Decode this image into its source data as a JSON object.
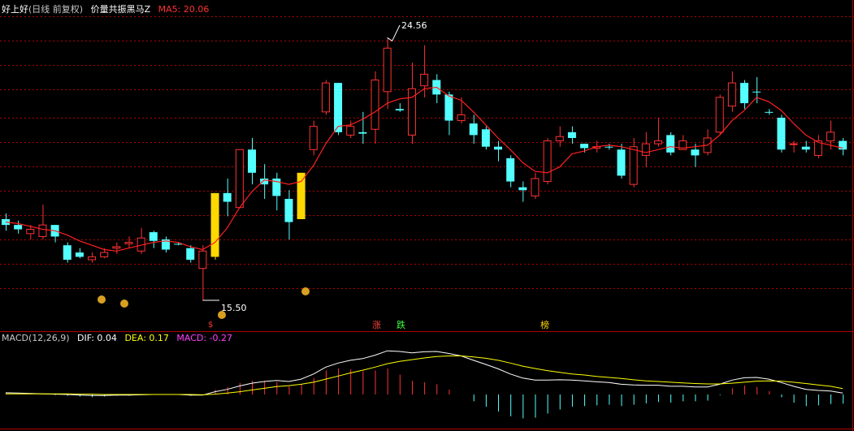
{
  "header": {
    "stock": "好上好",
    "period": "(日线 前复权)",
    "indicator_name": "价量共振黑马Z",
    "ma_label": "MA5: 20.06"
  },
  "macd_header": {
    "name": "MACD(12,26,9)",
    "dif": "DIF: 0.04",
    "dea": "DEA: 0.17",
    "macd": "MACD: -0.27"
  },
  "annotations": {
    "high_label": "24.56",
    "low_label": "15.50",
    "marker_zhang": "涨",
    "marker_die": "跌",
    "marker_bang": "榜"
  },
  "colors": {
    "up": "#ff3232",
    "down": "#54ffff",
    "signal": "#ffd800",
    "ma5": "#ff2020",
    "dif": "#ffffff",
    "dea": "#ffff00",
    "macd_text": "#ff40ff",
    "grid": "#b00000"
  },
  "chart_data": [
    {
      "type": "candlestick",
      "title": "价量共振黑马Z",
      "ylim": [
        14.8,
        25.3
      ],
      "high_marker": 24.56,
      "low_marker": 15.5,
      "series": [
        {
          "name": "K",
          "candles": [
            {
              "o": 18.3,
              "c": 18.1,
              "h": 18.5,
              "l": 17.9,
              "k": "d"
            },
            {
              "o": 18.1,
              "c": 17.95,
              "h": 18.25,
              "l": 17.8,
              "k": "d"
            },
            {
              "o": 17.8,
              "c": 17.95,
              "h": 18.1,
              "l": 17.6,
              "k": "u"
            },
            {
              "o": 17.7,
              "c": 18.1,
              "h": 18.8,
              "l": 17.6,
              "k": "u"
            },
            {
              "o": 18.1,
              "c": 17.7,
              "h": 18.1,
              "l": 17.5,
              "k": "d"
            },
            {
              "o": 17.4,
              "c": 16.9,
              "h": 17.5,
              "l": 16.8,
              "k": "d"
            },
            {
              "o": 17.15,
              "c": 17.0,
              "h": 17.3,
              "l": 16.95,
              "k": "d"
            },
            {
              "o": 16.9,
              "c": 17.0,
              "h": 17.15,
              "l": 16.8,
              "k": "u"
            },
            {
              "o": 17.0,
              "c": 17.15,
              "h": 17.3,
              "l": 16.95,
              "k": "u"
            },
            {
              "o": 17.3,
              "c": 17.35,
              "h": 17.5,
              "l": 17.1,
              "k": "u"
            },
            {
              "o": 17.45,
              "c": 17.5,
              "h": 17.7,
              "l": 17.3,
              "k": "u"
            },
            {
              "o": 17.2,
              "c": 17.65,
              "h": 18.0,
              "l": 17.1,
              "k": "u"
            },
            {
              "o": 17.85,
              "c": 17.55,
              "h": 17.9,
              "l": 17.3,
              "k": "d"
            },
            {
              "o": 17.6,
              "c": 17.25,
              "h": 17.7,
              "l": 17.15,
              "k": "d"
            },
            {
              "o": 17.45,
              "c": 17.45,
              "h": 17.5,
              "l": 17.4,
              "k": "d"
            },
            {
              "o": 17.3,
              "c": 16.9,
              "h": 17.4,
              "l": 16.8,
              "k": "d"
            },
            {
              "o": 16.6,
              "c": 17.2,
              "h": 17.4,
              "l": 15.5,
              "k": "u"
            },
            {
              "o": 17.0,
              "c": 19.2,
              "h": 19.2,
              "l": 16.9,
              "k": "s"
            },
            {
              "o": 19.2,
              "c": 18.9,
              "h": 19.7,
              "l": 18.4,
              "k": "d"
            },
            {
              "o": 18.7,
              "c": 20.7,
              "h": 20.7,
              "l": 18.7,
              "k": "u"
            },
            {
              "o": 20.7,
              "c": 19.9,
              "h": 21.1,
              "l": 19.5,
              "k": "d"
            },
            {
              "o": 19.7,
              "c": 19.5,
              "h": 20.2,
              "l": 19.0,
              "k": "d"
            },
            {
              "o": 19.7,
              "c": 19.1,
              "h": 19.9,
              "l": 18.6,
              "k": "d"
            },
            {
              "o": 19.0,
              "c": 18.2,
              "h": 19.3,
              "l": 17.6,
              "k": "d"
            },
            {
              "o": 18.3,
              "c": 19.9,
              "h": 19.9,
              "l": 18.3,
              "k": "s"
            },
            {
              "o": 20.7,
              "c": 21.5,
              "h": 21.7,
              "l": 20.5,
              "k": "u"
            },
            {
              "o": 22.0,
              "c": 23.0,
              "h": 23.1,
              "l": 21.9,
              "k": "u"
            },
            {
              "o": 23.0,
              "c": 21.3,
              "h": 23.0,
              "l": 21.2,
              "k": "d"
            },
            {
              "o": 21.2,
              "c": 21.5,
              "h": 21.7,
              "l": 21.1,
              "k": "u"
            },
            {
              "o": 21.3,
              "c": 21.25,
              "h": 22.0,
              "l": 20.9,
              "k": "d"
            },
            {
              "o": 21.4,
              "c": 23.1,
              "h": 23.4,
              "l": 20.9,
              "k": "u"
            },
            {
              "o": 22.7,
              "c": 24.2,
              "h": 24.56,
              "l": 22.1,
              "k": "u"
            },
            {
              "o": 22.1,
              "c": 22.05,
              "h": 22.3,
              "l": 22.0,
              "k": "d"
            },
            {
              "o": 21.2,
              "c": 22.8,
              "h": 23.7,
              "l": 20.9,
              "k": "u"
            },
            {
              "o": 22.9,
              "c": 23.3,
              "h": 24.3,
              "l": 22.5,
              "k": "u"
            },
            {
              "o": 23.1,
              "c": 22.6,
              "h": 23.3,
              "l": 22.3,
              "k": "d"
            },
            {
              "o": 22.6,
              "c": 21.7,
              "h": 22.7,
              "l": 21.2,
              "k": "d"
            },
            {
              "o": 21.7,
              "c": 21.9,
              "h": 22.5,
              "l": 21.6,
              "k": "u"
            },
            {
              "o": 21.6,
              "c": 21.2,
              "h": 21.9,
              "l": 20.9,
              "k": "d"
            },
            {
              "o": 21.4,
              "c": 20.8,
              "h": 21.5,
              "l": 20.7,
              "k": "d"
            },
            {
              "o": 20.8,
              "c": 20.7,
              "h": 21.0,
              "l": 20.3,
              "k": "d"
            },
            {
              "o": 20.4,
              "c": 19.6,
              "h": 20.5,
              "l": 19.4,
              "k": "d"
            },
            {
              "o": 19.4,
              "c": 19.3,
              "h": 19.6,
              "l": 18.9,
              "k": "d"
            },
            {
              "o": 19.1,
              "c": 19.7,
              "h": 19.9,
              "l": 19.0,
              "k": "u"
            },
            {
              "o": 19.6,
              "c": 21.0,
              "h": 21.1,
              "l": 19.5,
              "k": "u"
            },
            {
              "o": 21.0,
              "c": 21.15,
              "h": 21.5,
              "l": 20.8,
              "k": "u"
            },
            {
              "o": 21.3,
              "c": 21.1,
              "h": 21.5,
              "l": 20.9,
              "k": "d"
            },
            {
              "o": 20.9,
              "c": 20.75,
              "h": 20.9,
              "l": 20.6,
              "k": "d"
            },
            {
              "o": 20.75,
              "c": 20.8,
              "h": 21.0,
              "l": 20.6,
              "k": "u"
            },
            {
              "o": 20.8,
              "c": 20.8,
              "h": 20.9,
              "l": 20.7,
              "k": "d"
            },
            {
              "o": 20.7,
              "c": 19.8,
              "h": 20.9,
              "l": 19.7,
              "k": "d"
            },
            {
              "o": 19.5,
              "c": 20.8,
              "h": 21.1,
              "l": 19.4,
              "k": "u"
            },
            {
              "o": 20.5,
              "c": 20.9,
              "h": 21.3,
              "l": 20.1,
              "k": "u"
            },
            {
              "o": 20.9,
              "c": 21.0,
              "h": 21.8,
              "l": 20.8,
              "k": "u"
            },
            {
              "o": 21.2,
              "c": 20.6,
              "h": 21.3,
              "l": 20.5,
              "k": "d"
            },
            {
              "o": 20.7,
              "c": 21.0,
              "h": 21.2,
              "l": 20.7,
              "k": "u"
            },
            {
              "o": 20.7,
              "c": 20.5,
              "h": 20.9,
              "l": 20.1,
              "k": "d"
            },
            {
              "o": 20.6,
              "c": 21.1,
              "h": 21.4,
              "l": 20.5,
              "k": "u"
            },
            {
              "o": 21.3,
              "c": 22.5,
              "h": 22.6,
              "l": 21.2,
              "k": "u"
            },
            {
              "o": 22.2,
              "c": 23.0,
              "h": 23.4,
              "l": 22.0,
              "k": "u"
            },
            {
              "o": 23.0,
              "c": 22.3,
              "h": 23.1,
              "l": 22.1,
              "k": "d"
            },
            {
              "o": 22.7,
              "c": 22.7,
              "h": 23.2,
              "l": 22.3,
              "k": "d"
            },
            {
              "o": 22.0,
              "c": 22.0,
              "h": 22.1,
              "l": 21.9,
              "k": "d"
            },
            {
              "o": 21.8,
              "c": 20.7,
              "h": 21.9,
              "l": 20.6,
              "k": "d"
            },
            {
              "o": 20.9,
              "c": 20.9,
              "h": 21.0,
              "l": 20.6,
              "k": "u"
            },
            {
              "o": 20.8,
              "c": 20.7,
              "h": 21.0,
              "l": 20.6,
              "k": "d"
            },
            {
              "o": 20.5,
              "c": 21.0,
              "h": 21.2,
              "l": 20.4,
              "k": "u"
            },
            {
              "o": 21.0,
              "c": 21.3,
              "h": 21.7,
              "l": 20.7,
              "k": "u"
            },
            {
              "o": 21.0,
              "c": 20.7,
              "h": 21.1,
              "l": 20.5,
              "k": "d"
            }
          ]
        },
        {
          "name": "MA5",
          "values": [
            18.2,
            18.15,
            18.05,
            17.95,
            17.9,
            17.75,
            17.55,
            17.4,
            17.25,
            17.2,
            17.3,
            17.4,
            17.5,
            17.55,
            17.5,
            17.35,
            17.25,
            17.5,
            18.0,
            18.7,
            19.25,
            19.65,
            19.6,
            19.5,
            19.6,
            20.15,
            20.9,
            21.5,
            21.55,
            21.75,
            22.0,
            22.3,
            22.45,
            22.5,
            22.8,
            22.85,
            22.55,
            22.4,
            22.0,
            21.55,
            21.1,
            20.7,
            20.25,
            19.95,
            19.9,
            20.1,
            20.55,
            20.65,
            20.8,
            20.85,
            20.8,
            20.7,
            20.6,
            20.7,
            20.8,
            20.75,
            20.8,
            20.85,
            21.2,
            21.7,
            22.05,
            22.5,
            22.35,
            22.05,
            21.6,
            21.2,
            20.95,
            20.85,
            20.75
          ]
        }
      ]
    },
    {
      "type": "line",
      "title": "MACD(12,26,9)",
      "ylim": [
        -0.9,
        1.45
      ],
      "series": [
        {
          "name": "DIF",
          "values": [
            0.05,
            0.04,
            0.03,
            0.02,
            0.01,
            0.0,
            -0.02,
            -0.03,
            -0.03,
            -0.02,
            -0.02,
            -0.01,
            0.0,
            0.0,
            0.0,
            -0.02,
            -0.02,
            0.08,
            0.15,
            0.25,
            0.33,
            0.38,
            0.41,
            0.38,
            0.45,
            0.6,
            0.8,
            0.92,
            1.0,
            1.05,
            1.15,
            1.28,
            1.26,
            1.22,
            1.25,
            1.26,
            1.2,
            1.13,
            1.0,
            0.88,
            0.75,
            0.6,
            0.48,
            0.42,
            0.42,
            0.43,
            0.42,
            0.4,
            0.37,
            0.35,
            0.3,
            0.28,
            0.27,
            0.27,
            0.24,
            0.24,
            0.22,
            0.22,
            0.3,
            0.42,
            0.49,
            0.5,
            0.45,
            0.35,
            0.24,
            0.15,
            0.12,
            0.1,
            0.04
          ]
        },
        {
          "name": "DEA",
          "values": [
            0.02,
            0.02,
            0.02,
            0.02,
            0.02,
            0.02,
            0.01,
            0.01,
            0.0,
            0.0,
            0.0,
            0.0,
            0.0,
            0.0,
            0.0,
            0.0,
            -0.01,
            0.01,
            0.04,
            0.08,
            0.13,
            0.18,
            0.23,
            0.26,
            0.3,
            0.36,
            0.45,
            0.54,
            0.63,
            0.71,
            0.8,
            0.9,
            0.97,
            1.02,
            1.07,
            1.11,
            1.13,
            1.13,
            1.1,
            1.06,
            1.0,
            0.92,
            0.83,
            0.76,
            0.7,
            0.65,
            0.6,
            0.57,
            0.53,
            0.5,
            0.47,
            0.43,
            0.4,
            0.38,
            0.36,
            0.34,
            0.32,
            0.31,
            0.31,
            0.33,
            0.36,
            0.39,
            0.4,
            0.39,
            0.36,
            0.32,
            0.28,
            0.24,
            0.17
          ]
        },
        {
          "name": "MACD",
          "values": [
            0.06,
            0.04,
            0.02,
            0.0,
            -0.02,
            -0.04,
            -0.06,
            -0.08,
            -0.06,
            -0.04,
            -0.04,
            -0.02,
            0.0,
            0.0,
            0.0,
            -0.04,
            -0.02,
            0.14,
            0.22,
            0.34,
            0.4,
            0.4,
            0.36,
            0.24,
            0.3,
            0.48,
            0.7,
            0.76,
            0.74,
            0.68,
            0.7,
            0.76,
            0.58,
            0.4,
            0.36,
            0.3,
            0.14,
            0.0,
            -0.2,
            -0.36,
            -0.5,
            -0.64,
            -0.7,
            -0.68,
            -0.56,
            -0.44,
            -0.36,
            -0.34,
            -0.32,
            -0.3,
            -0.34,
            -0.3,
            -0.26,
            -0.22,
            -0.24,
            -0.2,
            -0.2,
            -0.18,
            -0.02,
            0.18,
            0.26,
            0.22,
            0.1,
            -0.08,
            -0.24,
            -0.34,
            -0.32,
            -0.28,
            -0.27
          ]
        }
      ]
    }
  ]
}
